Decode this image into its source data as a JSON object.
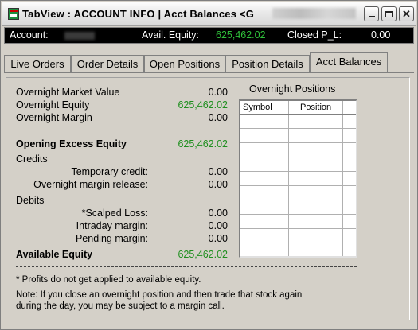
{
  "window": {
    "title": "TabView : ACCOUNT INFO | Acct Balances <G"
  },
  "header": {
    "account_label": "Account:",
    "equity_label": "Avail. Equity:",
    "equity_value": "625,462.02",
    "closed_pl_label": "Closed P_L:",
    "closed_pl_value": "0.00"
  },
  "tabs": [
    {
      "label": "Live Orders",
      "active": false
    },
    {
      "label": "Order Details",
      "active": false
    },
    {
      "label": "Open Positions",
      "active": false
    },
    {
      "label": "Position Details",
      "active": false
    },
    {
      "label": "Acct Balances",
      "active": true
    }
  ],
  "balances": {
    "overnight_market_value": {
      "label": "Overnight Market Value",
      "value": "0.00"
    },
    "overnight_equity": {
      "label": "Overnight Equity",
      "value": "625,462.02"
    },
    "overnight_margin": {
      "label": "Overnight Margin",
      "value": "0.00"
    },
    "opening_excess_equity": {
      "label": "Opening Excess Equity",
      "value": "625,462.02"
    },
    "credits_heading": "Credits",
    "temporary_credit": {
      "label": "Temporary credit:",
      "value": "0.00"
    },
    "overnight_margin_release": {
      "label": "Overnight margin release:",
      "value": "0.00"
    },
    "debits_heading": "Debits",
    "scalped_loss": {
      "label": "*Scalped Loss:",
      "value": "0.00"
    },
    "intraday_margin": {
      "label": "Intraday margin:",
      "value": "0.00"
    },
    "pending_margin": {
      "label": "Pending margin:",
      "value": "0.00"
    },
    "available_equity": {
      "label": "Available Equity",
      "value": "625,462.02"
    }
  },
  "overnight_positions": {
    "title": "Overnight Positions",
    "columns": [
      "Symbol",
      "Position"
    ]
  },
  "notes": {
    "profits_note": "* Profits do not get applied to available equity.",
    "margin_note_line1": "Note: If you close an overnight position and then trade that stock again",
    "margin_note_line2": "during the day, you may be subject to a margin call."
  },
  "colors": {
    "positive_value": "#1f8f1f",
    "header_equity": "#2fbf3a",
    "header_background": "#000000"
  }
}
